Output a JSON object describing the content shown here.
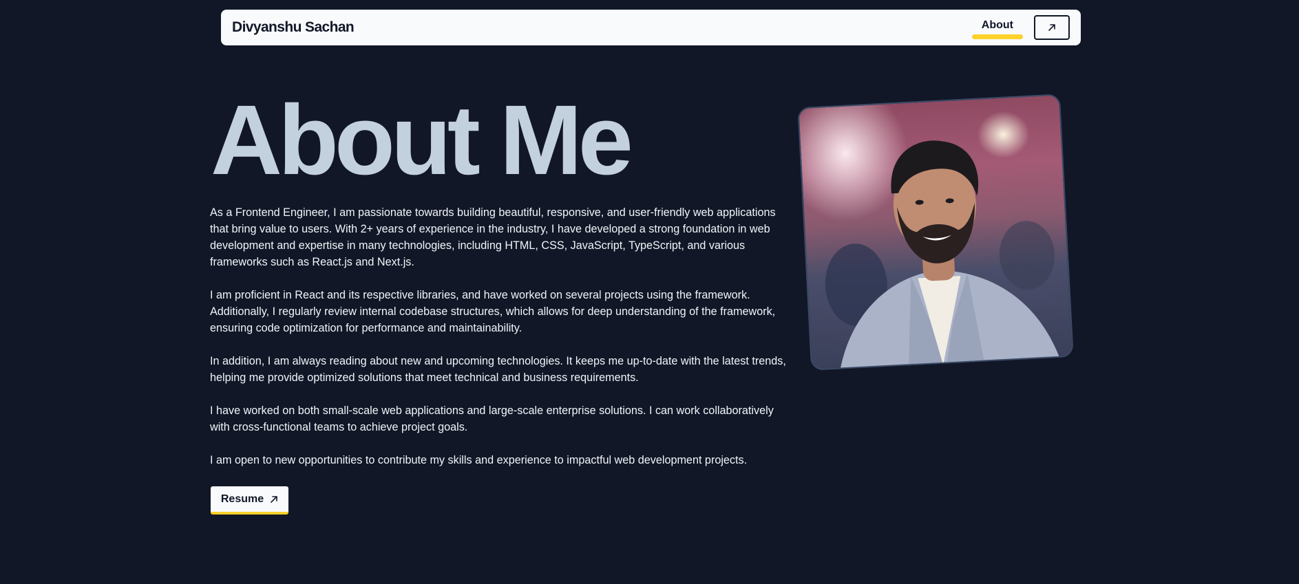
{
  "navbar": {
    "brand": "Divyanshu Sachan",
    "about_label": "About",
    "external_icon": "arrow-up-right-icon"
  },
  "main": {
    "heading": "About Me",
    "paragraphs": [
      "As a Frontend Engineer, I am passionate towards building beautiful, responsive, and user-friendly web applications that bring value to users. With 2+ years of experience in the industry, I have developed a strong foundation in web development and expertise in many technologies, including HTML, CSS, JavaScript, TypeScript, and various frameworks such as React.js and Next.js.",
      "I am proficient in React and its respective libraries, and have worked on several projects using the framework. Additionally, I regularly review internal codebase structures, which allows for deep understanding of the framework, ensuring code optimization for performance and maintainability.",
      "In addition, I am always reading about new and upcoming technologies. It keeps me up-to-date with the latest trends, helping me provide optimized solutions that meet technical and business requirements.",
      "I have worked on both small-scale web applications and large-scale enterprise solutions. I can work collaboratively with cross-functional teams to achieve project goals.",
      "I am open to new opportunities to contribute my skills and experience to impactful web development projects."
    ],
    "resume_label": "Resume",
    "resume_icon": "arrow-up-right-icon"
  },
  "colors": {
    "background": "#111727",
    "heading": "#c3d0de",
    "accent": "#fcd12a",
    "surface": "#f8fafc"
  }
}
